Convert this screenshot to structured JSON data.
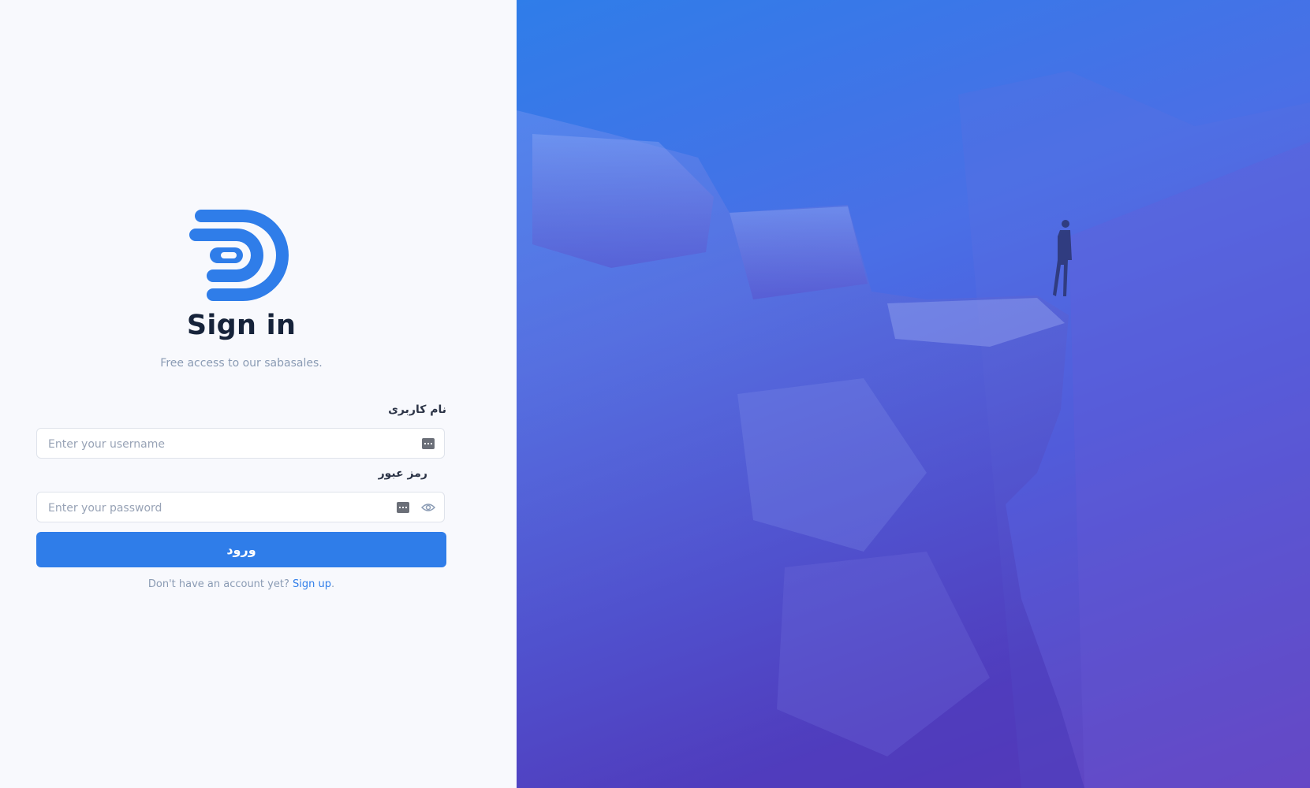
{
  "brand": {
    "logo_icon": "stacked-d-logo-icon",
    "accent_color": "#2f7de9"
  },
  "signin": {
    "title": "Sign in",
    "subtitle": "Free access to our sabasales."
  },
  "form": {
    "username_label": "نام کاربری",
    "username_placeholder": "Enter your username",
    "username_value": "",
    "password_label": "رمز عبور",
    "password_placeholder": "Enter your password",
    "password_value": "",
    "submit_label": "ورود",
    "field_icon": "keyboard-icon",
    "reveal_icon": "eye-icon"
  },
  "footer": {
    "prompt": "Don't have an account yet?",
    "signup_link": "Sign up",
    "period": "."
  },
  "hero": {
    "image_description_icon": "cliff-photo",
    "gradient_start": "#2f7de9",
    "gradient_end": "#6532b5"
  }
}
